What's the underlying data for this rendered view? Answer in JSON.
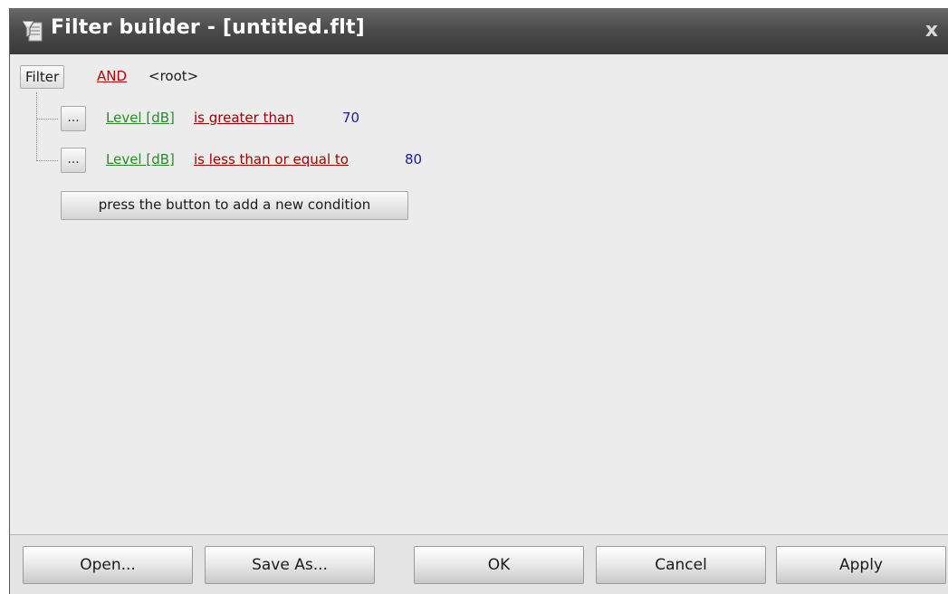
{
  "window": {
    "title": "Filter builder - [untitled.flt]",
    "close_glyph": "x",
    "icon": "filter-funnel-icon"
  },
  "filter": {
    "button_label": "Filter",
    "group_operator": "AND",
    "root_label": "<root>",
    "conditions": [
      {
        "menu_label": "...",
        "field": "Level [dB]",
        "operator": "is greater than",
        "value": "70"
      },
      {
        "menu_label": "...",
        "field": "Level [dB]",
        "operator": "is less than or equal to",
        "value": "80"
      }
    ],
    "add_condition_label": "press the button to add a new condition"
  },
  "footer": {
    "open_label": "Open...",
    "save_as_label": "Save As...",
    "ok_label": "OK",
    "cancel_label": "Cancel",
    "apply_label": "Apply"
  },
  "colors": {
    "operator_and": "#c00000",
    "field": "#2a8a2a",
    "condition_operator": "#a00000",
    "value": "#1a1aa0"
  }
}
